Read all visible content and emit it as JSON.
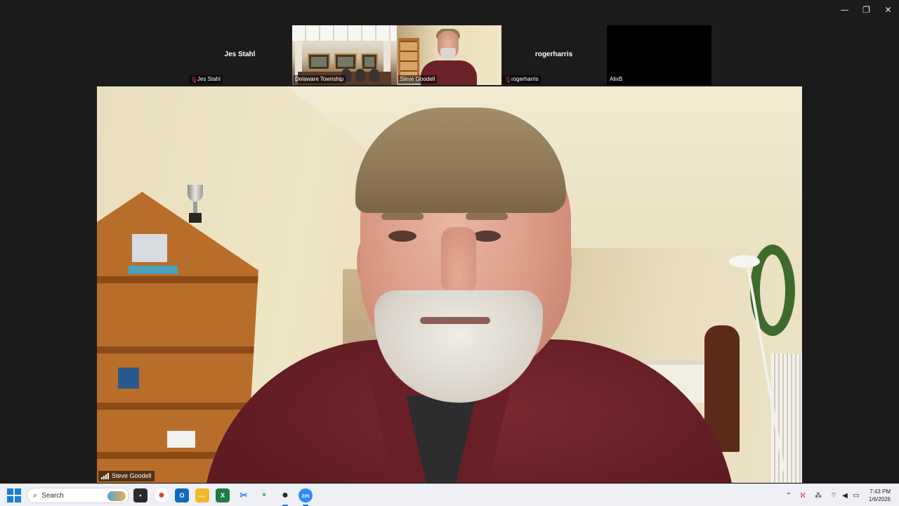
{
  "window": {
    "controls": {
      "minimize": "—",
      "restore": "❐",
      "close": "✕"
    }
  },
  "participants": [
    {
      "id": "jes",
      "name": "Jes Stahl",
      "label": "Jes Stahl",
      "muted": true,
      "video": false
    },
    {
      "id": "delaware",
      "label": "Delaware Township",
      "muted": false,
      "video": true
    },
    {
      "id": "steve",
      "label": "Steve Goodell",
      "muted": false,
      "video": true,
      "speaking": true
    },
    {
      "id": "roger",
      "name": "rogerharris",
      "label": "rogerharris",
      "muted": true,
      "video": false
    },
    {
      "id": "alix",
      "label": "AlixB",
      "muted": false,
      "video": false
    }
  ],
  "main_video": {
    "speaker_label": "Steve Goodell"
  },
  "taskbar": {
    "search_placeholder": "Search",
    "apps": [
      {
        "name": "task-view",
        "glyph": "▪",
        "color": "#2b2b2b"
      },
      {
        "name": "chrome",
        "glyph": "●",
        "color": "#db4437"
      },
      {
        "name": "outlook",
        "glyph": "O",
        "color": "#0f6cbd"
      },
      {
        "name": "file-explorer",
        "glyph": "▬",
        "color": "#f2b72b"
      },
      {
        "name": "excel",
        "glyph": "X",
        "color": "#1e7c45"
      },
      {
        "name": "snipping-tool",
        "glyph": "✂",
        "color": "#2f7ed8"
      },
      {
        "name": "app-green",
        "glyph": "•",
        "color": "#58b368"
      },
      {
        "name": "camera-app",
        "glyph": "●",
        "color": "#2a2a2a"
      },
      {
        "name": "zoom",
        "glyph": "zm",
        "color": "#2d8cff"
      }
    ],
    "tray": {
      "overflow": "⌃",
      "icons": [
        "ℵ",
        "⁂",
        "⌔",
        "◀",
        "▭"
      ],
      "time": "7:43 PM",
      "date": "1/6/2026"
    }
  }
}
